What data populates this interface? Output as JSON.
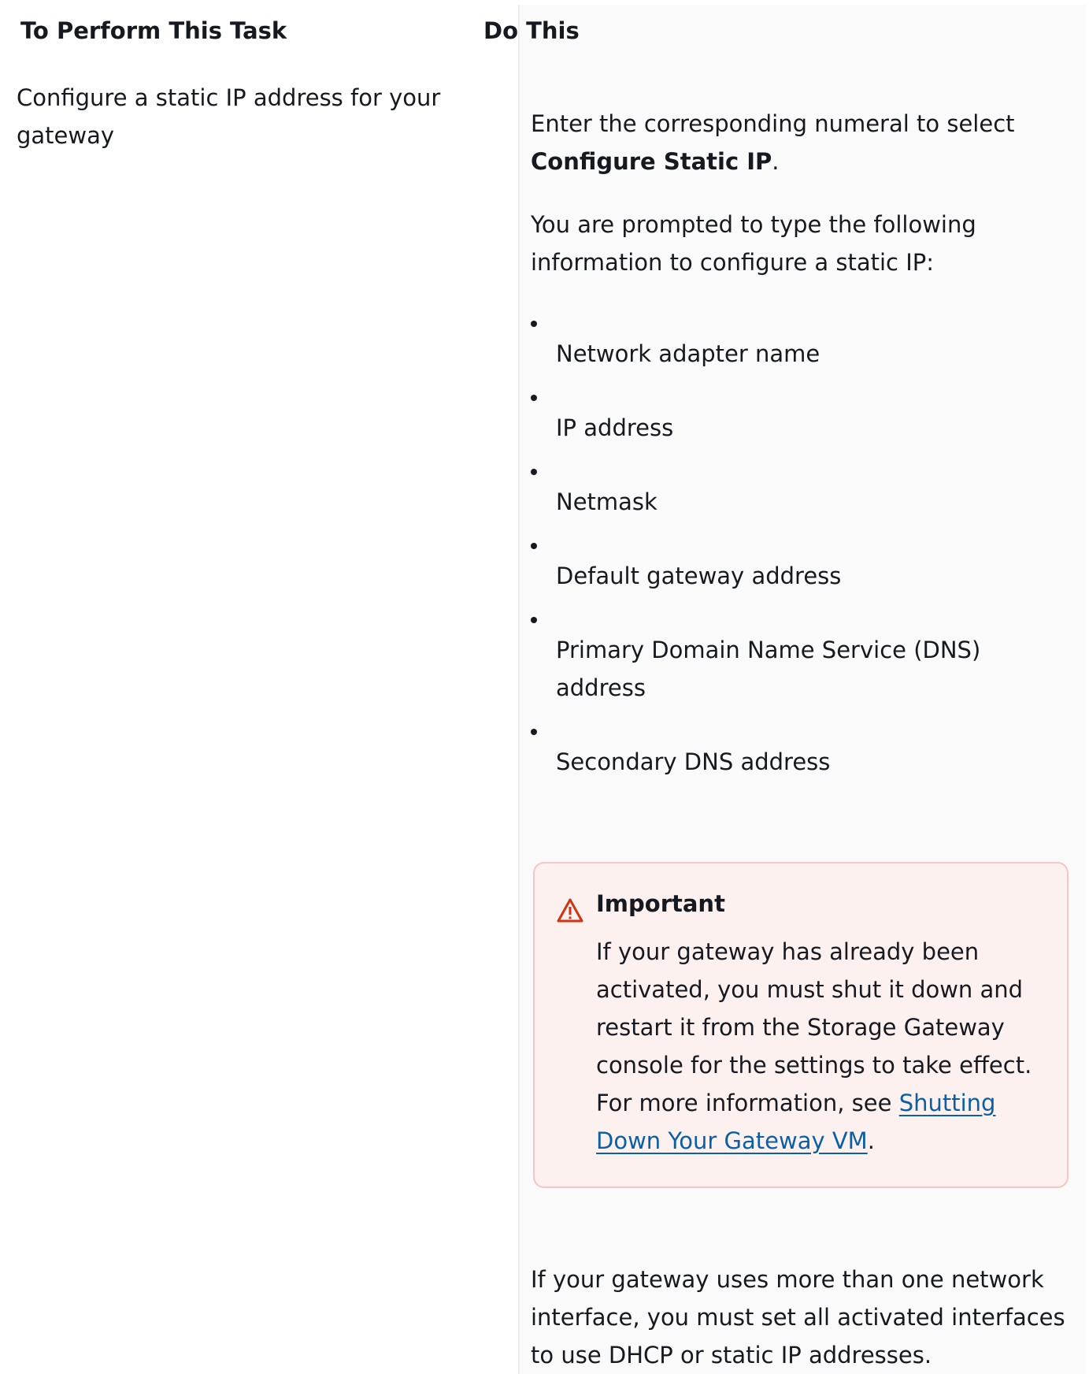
{
  "header": {
    "col1": "To Perform This Task",
    "col2": "Do This"
  },
  "row": {
    "task": "Configure a static IP address for your gateway",
    "intro_prefix": "Enter the corresponding numeral to select ",
    "intro_bold": "Configure Static IP",
    "intro_suffix": ".",
    "prompt_text": "You are prompted to type the following information to  configure a static IP:",
    "items": [
      "Network adapter name",
      "IP address",
      "Netmask",
      "Default gateway address",
      "Primary Domain Name Service (DNS) address",
      "Secondary DNS address"
    ],
    "important": {
      "icon": "warning-triangle-icon",
      "accent_color": "#d13212",
      "title": "Important",
      "body": "If your gateway has already been activated, you must  shut it down and restart it from the Storage Gateway console for  the settings to take effect. For more information, see  ",
      "link_text": "Shutting Down Your Gateway VM",
      "after_link": "."
    },
    "footer_note": "If your gateway uses more than one network interface, you  must set all activated interfaces to use DHCP or static IP  addresses."
  }
}
